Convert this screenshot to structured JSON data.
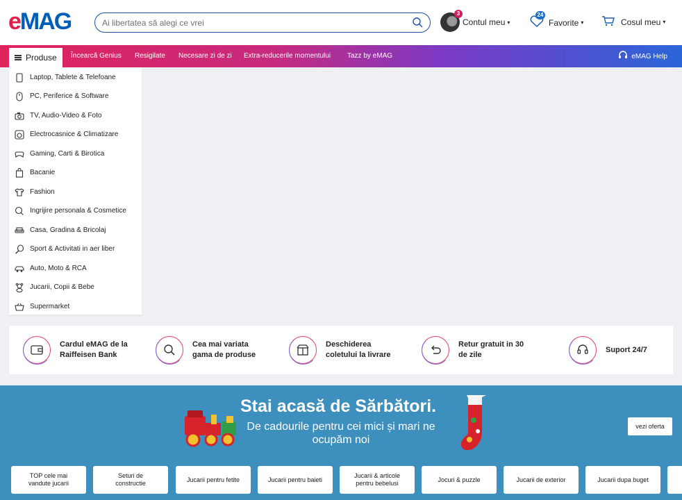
{
  "header": {
    "logo": "eMAG",
    "search_placeholder": "Ai libertatea să alegi ce vrei",
    "account_label": "Contul meu",
    "account_badge": "3",
    "favorites_label": "Favorite",
    "favorites_badge": "24",
    "cart_label": "Cosul meu"
  },
  "nav": {
    "products_label": "Produse",
    "links": [
      "Încearcă Genius",
      "Resigilate",
      "Necesare zi de zi",
      "Extra-reducerile momentului",
      "Tazz by eMAG"
    ],
    "help_label": "eMAG Help"
  },
  "menu": {
    "items": [
      {
        "label": "Laptop, Tablete & Telefoane",
        "icon": "phone-icon"
      },
      {
        "label": "PC, Periferice & Software",
        "icon": "mouse-icon"
      },
      {
        "label": "TV, Audio-Video & Foto",
        "icon": "camera-icon"
      },
      {
        "label": "Electrocasnice & Climatizare",
        "icon": "appliance-icon"
      },
      {
        "label": "Gaming, Carti & Birotica",
        "icon": "gamepad-icon"
      },
      {
        "label": "Bacanie",
        "icon": "bag-icon"
      },
      {
        "label": "Fashion",
        "icon": "tshirt-icon"
      },
      {
        "label": "Ingrijire personala & Cosmetice",
        "icon": "care-icon"
      },
      {
        "label": "Casa, Gradina & Bricolaj",
        "icon": "sofa-icon"
      },
      {
        "label": "Sport & Activitati in aer liber",
        "icon": "racket-icon"
      },
      {
        "label": "Auto, Moto & RCA",
        "icon": "car-icon"
      },
      {
        "label": "Jucarii, Copii & Bebe",
        "icon": "teddy-icon"
      },
      {
        "label": "Supermarket",
        "icon": "basket-icon"
      }
    ]
  },
  "benefits": [
    {
      "text": "Cardul eMAG de la\nRaiffeisen Bank",
      "icon": "wallet-icon"
    },
    {
      "text": "Cea mai variata\ngama de produse",
      "icon": "magnifier-icon"
    },
    {
      "text": "Deschiderea\ncoletului la livrare",
      "icon": "box-icon"
    },
    {
      "text": "Retur gratuit in 30\nde zile",
      "icon": "return-icon"
    },
    {
      "text": "Suport 24/7",
      "icon": "headset-icon"
    }
  ],
  "banner": {
    "title": "Stai acasă de Sărbători.",
    "subtitle": "De cadourile pentru cei mici și mari ne ocupăm noi",
    "cta": "vezi oferta",
    "categories": [
      "TOP cele mai\nvandute jucarii",
      "Seturi de\nconstructie",
      "Jucarii pentru fetite",
      "Jucarii pentru baieti",
      "Jucarii & articole\npentru bebelusi",
      "Jocuri & puzzle",
      "Jucarii de exterior",
      "Jucarii dupa buget"
    ]
  },
  "colors": {
    "brand_blue": "#005eb8",
    "brand_red": "#e11d48",
    "banner_bg": "#3d8fbe"
  }
}
